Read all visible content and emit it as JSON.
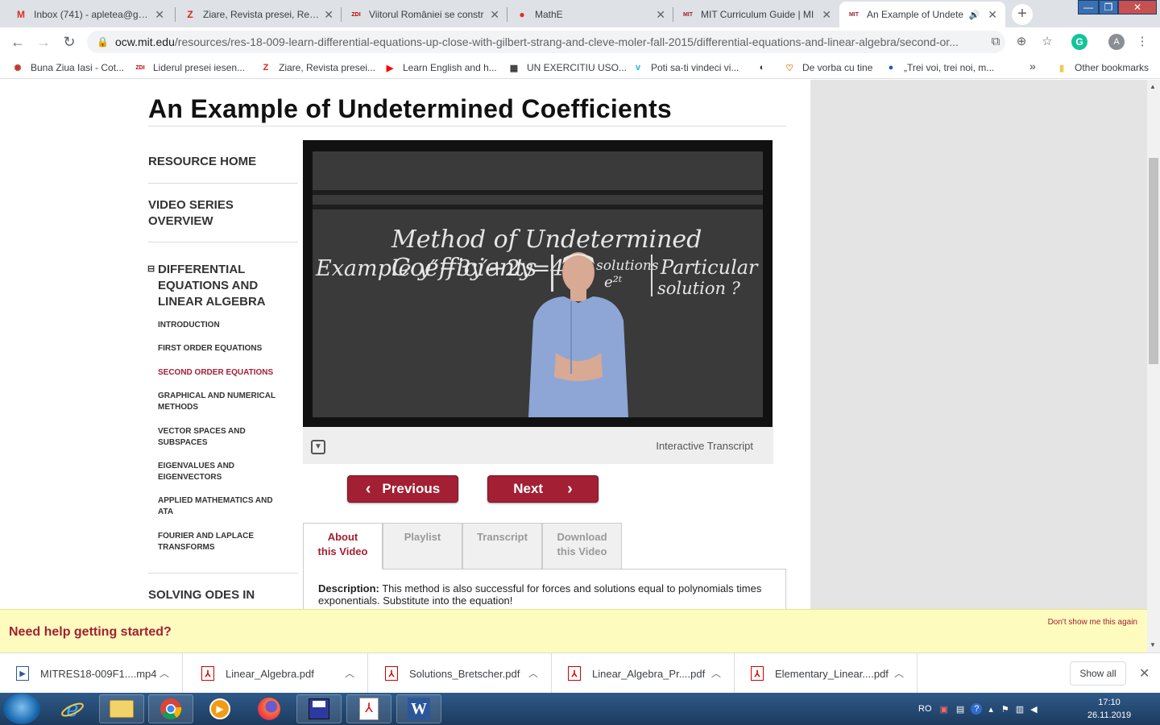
{
  "browser": {
    "tabs": [
      {
        "title": "Inbox (741) - apletea@gma",
        "icon": "gmail-icon",
        "icon_glyph": "M",
        "icon_color": "#d93025",
        "active": false
      },
      {
        "title": "Ziare, Revista presei, Revist",
        "icon": "ziare-icon",
        "icon_glyph": "Z",
        "icon_color": "#d7261e",
        "active": false
      },
      {
        "title": "Viitorul României se constr",
        "icon": "zdi-icon",
        "icon_glyph": "ZDI",
        "icon_color": "#c00000",
        "active": false
      },
      {
        "title": "MathE",
        "icon": "mathe-icon",
        "icon_glyph": "●",
        "icon_color": "#d93025",
        "active": false
      },
      {
        "title": "MIT Curriculum Guide | MI",
        "icon": "mit-ocw-icon",
        "icon_glyph": "MIT",
        "icon_color": "#a31f34",
        "active": false
      },
      {
        "title": "An Example of Undete",
        "icon": "mit-ocw-icon",
        "icon_glyph": "MIT",
        "icon_color": "#a31f34",
        "active": true
      }
    ],
    "url_host": "ocw.mit.edu",
    "url_path": "/resources/res-18-009-learn-differential-equations-up-close-with-gilbert-strang-and-cleve-moler-fall-2015/differential-equations-and-linear-algebra/second-or...",
    "bookmarks": [
      {
        "label": "Buna Ziua Iasi - Cot...",
        "icon": "bziasi-icon",
        "glyph": "✺",
        "color": "#c0392b"
      },
      {
        "label": "Liderul presei iesen...",
        "icon": "zdi-icon",
        "glyph": "ZDI",
        "color": "#c00000"
      },
      {
        "label": "Ziare, Revista presei...",
        "icon": "ziare-icon",
        "glyph": "Z",
        "color": "#d7261e"
      },
      {
        "label": "Learn English and h...",
        "icon": "youtube-icon",
        "glyph": "▶",
        "color": "#ff0000"
      },
      {
        "label": "UN EXERCITIU USO...",
        "icon": "exercise-icon",
        "glyph": "▦",
        "color": "#333"
      },
      {
        "label": "Poti sa-ti vindeci vi...",
        "icon": "vimeo-icon",
        "glyph": "v",
        "color": "#1ab7ea"
      },
      {
        "label": "",
        "icon": "globe-icon",
        "glyph": "◐",
        "color": "#333"
      },
      {
        "label": "De vorba cu tine",
        "icon": "heart-icon",
        "glyph": "♡",
        "color": "#e67e22"
      },
      {
        "label": "„Trei voi, trei noi, m...",
        "icon": "earth-icon",
        "glyph": "●",
        "color": "#1a5fb4"
      }
    ],
    "bookmarks_overflow": "»",
    "other_bookmarks": "Other bookmarks",
    "profile_initial": "A"
  },
  "page": {
    "title": "An Example of Undetermined Coefficients",
    "nav": {
      "resource_home": "RESOURCE HOME",
      "video_series_overview_1": "VIDEO SERIES",
      "video_series_overview_2": "OVERVIEW",
      "section_toggle": "⊟",
      "section_1": "DIFFERENTIAL",
      "section_2": "EQUATIONS AND",
      "section_3": "LINEAR ALGEBRA",
      "items": [
        {
          "l1": "INTRODUCTION",
          "l2": ""
        },
        {
          "l1": "FIRST ORDER EQUATIONS",
          "l2": ""
        },
        {
          "l1": "SECOND ORDER EQUATIONS",
          "l2": ""
        },
        {
          "l1": "GRAPHICAL AND NUMERICAL",
          "l2": "METHODS"
        },
        {
          "l1": "VECTOR SPACES AND",
          "l2": "SUBSPACES"
        },
        {
          "l1": "EIGENVALUES AND",
          "l2": "EIGENVECTORS"
        },
        {
          "l1": "APPLIED MATHEMATICS AND",
          "l2": "ATA"
        },
        {
          "l1": "FOURIER AND LAPLACE",
          "l2": "TRANSFORMS"
        }
      ],
      "solving_odes": "SOLVING ODES IN"
    },
    "video": {
      "board_line1": "Method of Undetermined Coefficients",
      "board_example": "Example  y″−3y′+2y=4t",
      "board_solutions": "solutions",
      "board_e2t": "e²ᵗ",
      "board_particular": "Particular",
      "board_solution_q": "solution ?"
    },
    "interactive_transcript": "Interactive Transcript",
    "previous": "Previous",
    "next": "Next",
    "tabs": [
      {
        "l1": "About",
        "l2": "this Video"
      },
      {
        "l1": "Playlist",
        "l2": ""
      },
      {
        "l1": "Transcript",
        "l2": ""
      },
      {
        "l1": "Download",
        "l2": "this Video"
      }
    ],
    "description_label": "Description:",
    "description_text": " This method is also successful for forces and solutions equal to polynomials times exponentials. Substitute into the equation!"
  },
  "banner": {
    "heading": "Need help getting started?",
    "dismiss": "Don't show me this again"
  },
  "downloads": {
    "items": [
      {
        "name": "MITRES18-009F1....mp4",
        "icon": "video-file-icon"
      },
      {
        "name": "Linear_Algebra.pdf",
        "icon": "pdf-file-icon"
      },
      {
        "name": "Solutions_Bretscher.pdf",
        "icon": "pdf-file-icon"
      },
      {
        "name": "Linear_Algebra_Pr....pdf",
        "icon": "pdf-file-icon"
      },
      {
        "name": "Elementary_Linear....pdf",
        "icon": "pdf-file-icon"
      }
    ],
    "show_all": "Show all"
  },
  "taskbar": {
    "lang": "RO",
    "time": "17:10",
    "date": "26.11.2019"
  },
  "colors": {
    "mit_red": "#a31f34",
    "banner_bg": "#fdfbbe"
  }
}
